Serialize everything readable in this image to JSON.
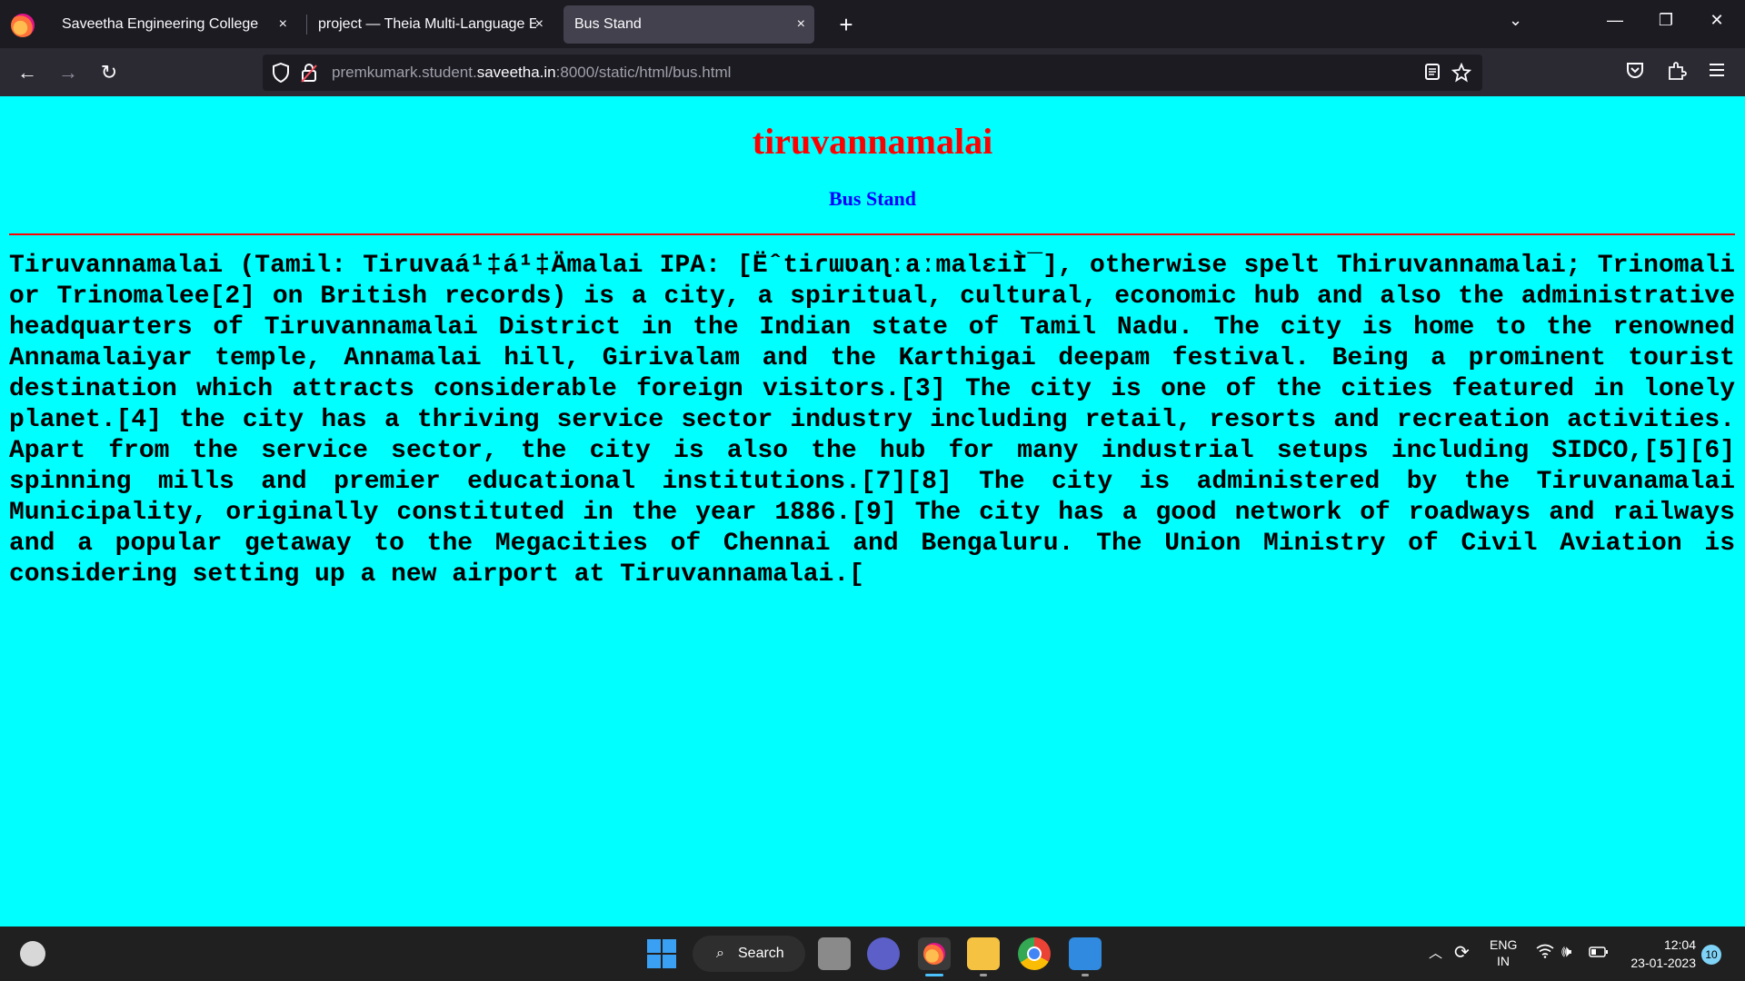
{
  "browser": {
    "tabs": [
      {
        "label": "Saveetha Engineering College",
        "close": "×"
      },
      {
        "label": "project — Theia Multi-Language Ex",
        "close": "×"
      },
      {
        "label": "Bus Stand",
        "close": "×",
        "active": true
      }
    ],
    "new_tab": "+",
    "tab_list": "⌄",
    "window_controls": {
      "minimize": "—",
      "restore": "❐",
      "close": "✕"
    },
    "nav": {
      "back": "←",
      "forward": "→",
      "reload": "↻"
    },
    "url": {
      "prefix": "premkumark.student.",
      "host": "saveetha.in",
      "suffix": ":8000/static/html/bus.html"
    }
  },
  "page": {
    "title": "tiruvannamalai",
    "subtitle": "Bus Stand",
    "body": "Tiruvannamalai (Tamil: Tiruvaá¹‡á¹‡Ämalai IPA: [ËˆtiɾɯʋaɳːaːmalɛiÌ¯], otherwise spelt Thiruvannamalai; Trinomali or Trinomalee[2] on British records) is a city, a spiritual, cultural, economic hub and also the administrative headquarters of Tiruvannamalai District in the Indian state of Tamil Nadu. The city is home to the renowned Annamalaiyar temple, Annamalai hill, Girivalam and the Karthigai deepam festival. Being a prominent tourist destination which attracts considerable foreign visitors.[3] The city is one of the cities featured in lonely planet.[4] the city has a thriving service sector industry including retail, resorts and recreation activities. Apart from the service sector, the city is also the hub for many industrial setups including SIDCO,[5][6] spinning mills and premier educational institutions.[7][8] The city is administered by the Tiruvanamalai Municipality, originally constituted in the year 1886.[9] The city has a good network of roadways and railways and a popular getaway to the Megacities of Chennai and Bengaluru. The Union Ministry of Civil Aviation is considering setting up a new airport at Tiruvannamalai.[",
    "colors": {
      "background": "#00ffff",
      "title": "#ff0000",
      "subtitle": "#0000ff",
      "rule": "#ff0000"
    }
  },
  "taskbar": {
    "search_label": "Search",
    "language": {
      "line1": "ENG",
      "line2": "IN"
    },
    "time": "12:04",
    "date": "23-01-2023",
    "notification_count": "10",
    "icons": [
      "weather-icon",
      "windows-start-icon",
      "search-icon",
      "task-view-icon",
      "chat-icon",
      "firefox-icon",
      "file-explorer-icon",
      "chrome-icon",
      "photos-icon"
    ]
  }
}
